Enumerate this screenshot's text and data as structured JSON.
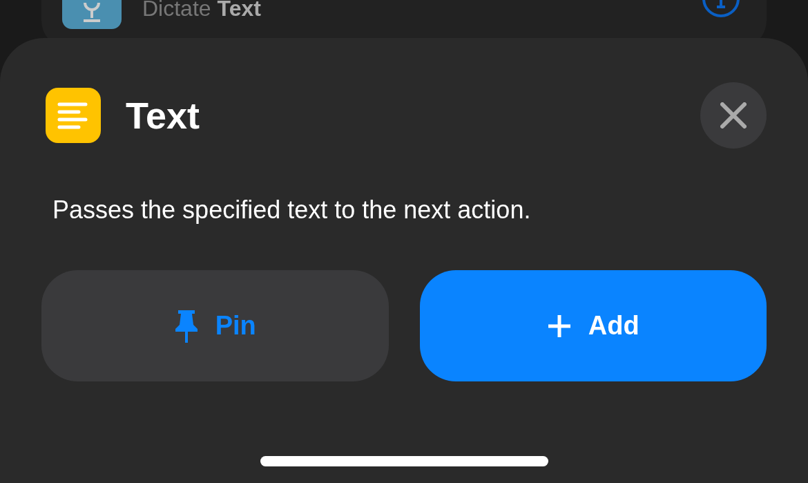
{
  "background_action": {
    "title": "Dictate **Text**"
  },
  "sheet": {
    "title": "Text",
    "description": "Passes the specified text to the next action.",
    "buttons": [
      {
        "kind": "pin",
        "label": "Pin"
      },
      {
        "kind": "add",
        "label": "Add"
      }
    ]
  }
}
